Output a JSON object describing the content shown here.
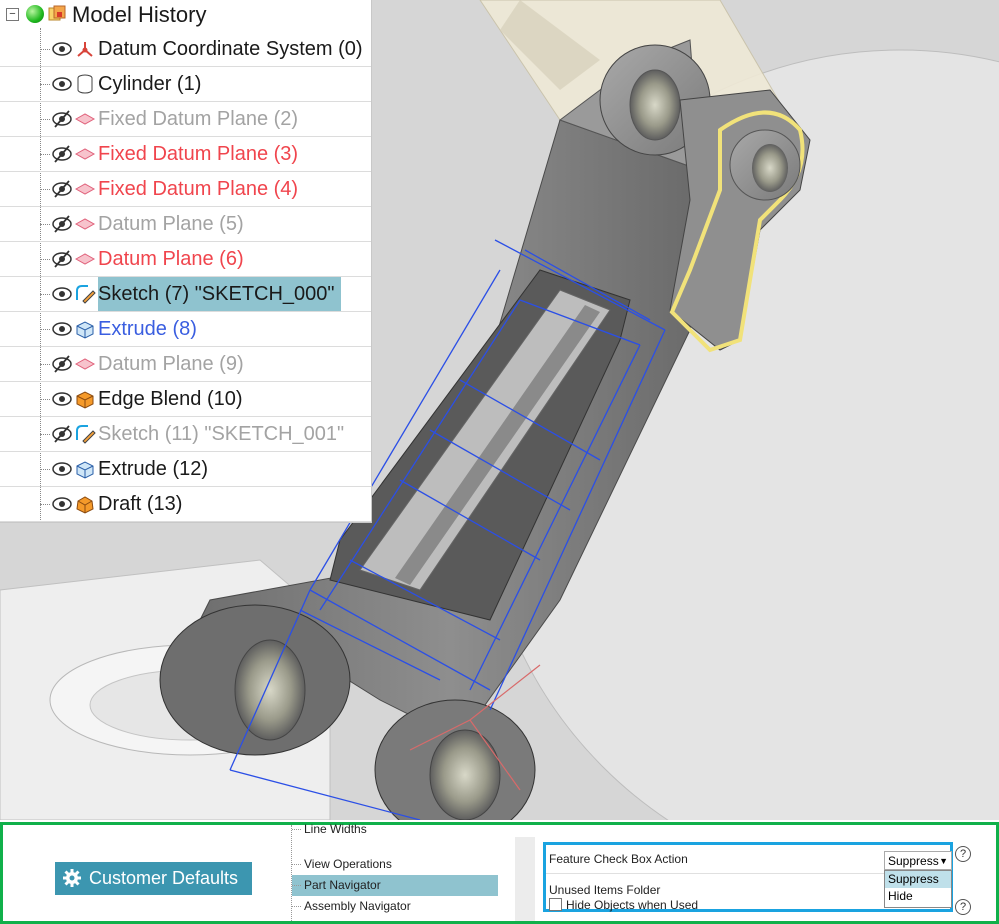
{
  "model_history": {
    "title": "Model History",
    "items": [
      {
        "label": "Datum Coordinate System (0)",
        "icon": "datum-csys-icon",
        "visible": true,
        "style": "black"
      },
      {
        "label": "Cylinder (1)",
        "icon": "cylinder-icon",
        "visible": true,
        "style": "black"
      },
      {
        "label": "Fixed Datum Plane (2)",
        "icon": "datum-plane-icon",
        "visible": false,
        "style": "gray"
      },
      {
        "label": "Fixed Datum Plane (3)",
        "icon": "datum-plane-icon",
        "visible": false,
        "style": "red"
      },
      {
        "label": "Fixed Datum Plane (4)",
        "icon": "datum-plane-icon",
        "visible": false,
        "style": "red"
      },
      {
        "label": "Datum Plane (5)",
        "icon": "datum-plane-icon",
        "visible": false,
        "style": "gray"
      },
      {
        "label": "Datum Plane (6)",
        "icon": "datum-plane-icon",
        "visible": false,
        "style": "red"
      },
      {
        "label": "Sketch (7) \"SKETCH_000\"",
        "icon": "sketch-icon",
        "visible": true,
        "style": "black",
        "selected": true
      },
      {
        "label": "Extrude (8)",
        "icon": "extrude-icon",
        "visible": true,
        "style": "blue"
      },
      {
        "label": "Datum Plane (9)",
        "icon": "datum-plane-icon",
        "visible": false,
        "style": "gray"
      },
      {
        "label": "Edge Blend (10)",
        "icon": "edge-blend-icon",
        "visible": true,
        "style": "black"
      },
      {
        "label": "Sketch (11) \"SKETCH_001\"",
        "icon": "sketch-icon",
        "visible": false,
        "style": "gray"
      },
      {
        "label": "Extrude (12)",
        "icon": "extrude-icon",
        "visible": true,
        "style": "black"
      },
      {
        "label": "Draft (13)",
        "icon": "draft-icon",
        "visible": true,
        "style": "black"
      }
    ]
  },
  "settings": {
    "customer_defaults_label": "Customer Defaults",
    "nav_items": [
      {
        "label": "Line Widths"
      },
      {
        "label": "View Operations"
      },
      {
        "label": "Part Navigator",
        "selected": true
      },
      {
        "label": "Assembly Navigator"
      }
    ],
    "feature_check_box_action_label": "Feature Check Box Action",
    "feature_check_box_action_value": "Suppress",
    "dropdown_options": [
      "Suppress",
      "Hide"
    ],
    "unused_items_folder_label": "Unused Items Folder",
    "hide_objects_label": "Hide Objects when Used",
    "help_glyph": "?"
  },
  "colors": {
    "selection": "#8fc3cf",
    "panel_border": "#10b04a",
    "options_border": "#1aa3e0",
    "button_bg": "#3c96b0",
    "sketch_lines": "#2b4fe6",
    "highlight_edge": "#f1e27a"
  }
}
